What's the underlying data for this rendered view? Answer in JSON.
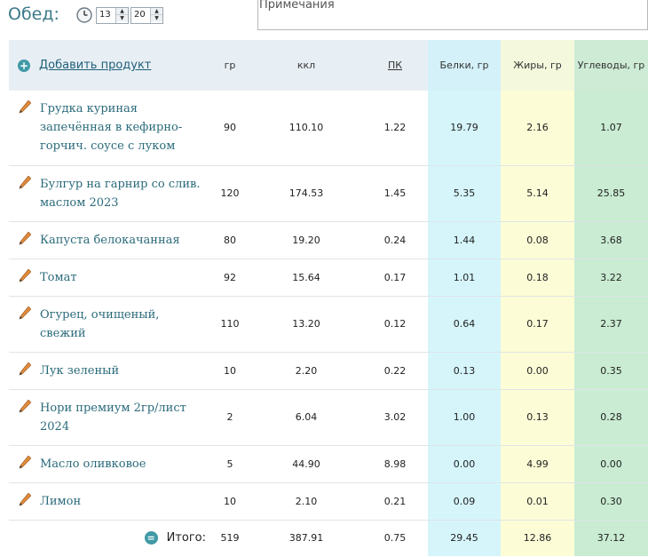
{
  "meal": {
    "title": "Обед:",
    "hour": "13",
    "minute": "20"
  },
  "notes": {
    "placeholder": "Примечания"
  },
  "table": {
    "add_label": "Добавить продукт",
    "headers": {
      "gr": "гр",
      "kcl": "ккл",
      "pk": "ПК",
      "protein": "Белки, гр",
      "fat": "Жиры, гр",
      "carbs": "Углеводы, гр"
    },
    "rows": [
      {
        "name": "Грудка куриная запечённая в кефирно-горчич. соусе с луком",
        "gr": "90",
        "kcl": "110.10",
        "pk": "1.22",
        "protein": "19.79",
        "fat": "2.16",
        "carbs": "1.07"
      },
      {
        "name": "Булгур на гарнир со слив. маслом 2023",
        "gr": "120",
        "kcl": "174.53",
        "pk": "1.45",
        "protein": "5.35",
        "fat": "5.14",
        "carbs": "25.85"
      },
      {
        "name": "Капуста белокачанная",
        "gr": "80",
        "kcl": "19.20",
        "pk": "0.24",
        "protein": "1.44",
        "fat": "0.08",
        "carbs": "3.68"
      },
      {
        "name": "Томат",
        "gr": "92",
        "kcl": "15.64",
        "pk": "0.17",
        "protein": "1.01",
        "fat": "0.18",
        "carbs": "3.22"
      },
      {
        "name": "Огурец, очищеный, свежий",
        "gr": "110",
        "kcl": "13.20",
        "pk": "0.12",
        "protein": "0.64",
        "fat": "0.17",
        "carbs": "2.37"
      },
      {
        "name": "Лук зеленый",
        "gr": "10",
        "kcl": "2.20",
        "pk": "0.22",
        "protein": "0.13",
        "fat": "0.00",
        "carbs": "0.35"
      },
      {
        "name": "Нори премиум 2гр/лист 2024",
        "gr": "2",
        "kcl": "6.04",
        "pk": "3.02",
        "protein": "1.00",
        "fat": "0.13",
        "carbs": "0.28"
      },
      {
        "name": "Масло оливковое",
        "gr": "5",
        "kcl": "44.90",
        "pk": "8.98",
        "protein": "0.00",
        "fat": "4.99",
        "carbs": "0.00"
      },
      {
        "name": "Лимон",
        "gr": "10",
        "kcl": "2.10",
        "pk": "0.21",
        "protein": "0.09",
        "fat": "0.01",
        "carbs": "0.30"
      }
    ],
    "total": {
      "label": "Итого:",
      "gr": "519",
      "kcl": "387.91",
      "pk": "0.75",
      "protein": "29.45",
      "fat": "12.86",
      "carbs": "37.12"
    }
  },
  "colors": {
    "accent": "#3f9aa6",
    "link": "#1f5f7a",
    "protein_bg": "#d5f5fb",
    "fat_bg": "#fcfdd6",
    "carbs_bg": "#c9ecd2"
  }
}
